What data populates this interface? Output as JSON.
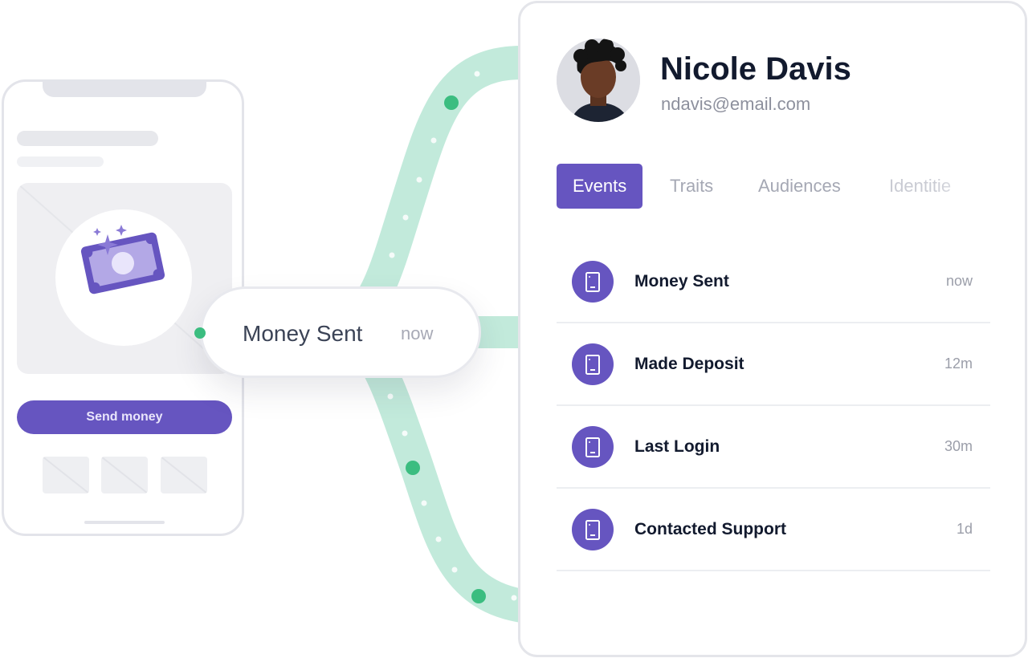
{
  "phone": {
    "send_button_label": "Send money",
    "icon": "money-bill-sparkle-icon"
  },
  "pill": {
    "event_name": "Money Sent",
    "event_time": "now"
  },
  "profile": {
    "name": "Nicole Davis",
    "email": "ndavis@email.com",
    "avatar": "user-avatar"
  },
  "tabs": [
    {
      "label": "Events"
    },
    {
      "label": "Traits"
    },
    {
      "label": "Audiences"
    },
    {
      "label": "Identitie"
    }
  ],
  "events": [
    {
      "name": "Money Sent",
      "time": "now",
      "icon": "mobile-device-icon"
    },
    {
      "name": "Made Deposit",
      "time": "12m",
      "icon": "mobile-device-icon"
    },
    {
      "name": "Last Login",
      "time": "30m",
      "icon": "mobile-device-icon"
    },
    {
      "name": "Contacted Support",
      "time": "1d",
      "icon": "mobile-device-icon"
    }
  ],
  "colors": {
    "accent": "#6655c0",
    "flow": "#bde8d4",
    "flow_dot": "#3bbd80",
    "text_dark": "#121a2e",
    "text_muted": "#9b9ea9"
  }
}
